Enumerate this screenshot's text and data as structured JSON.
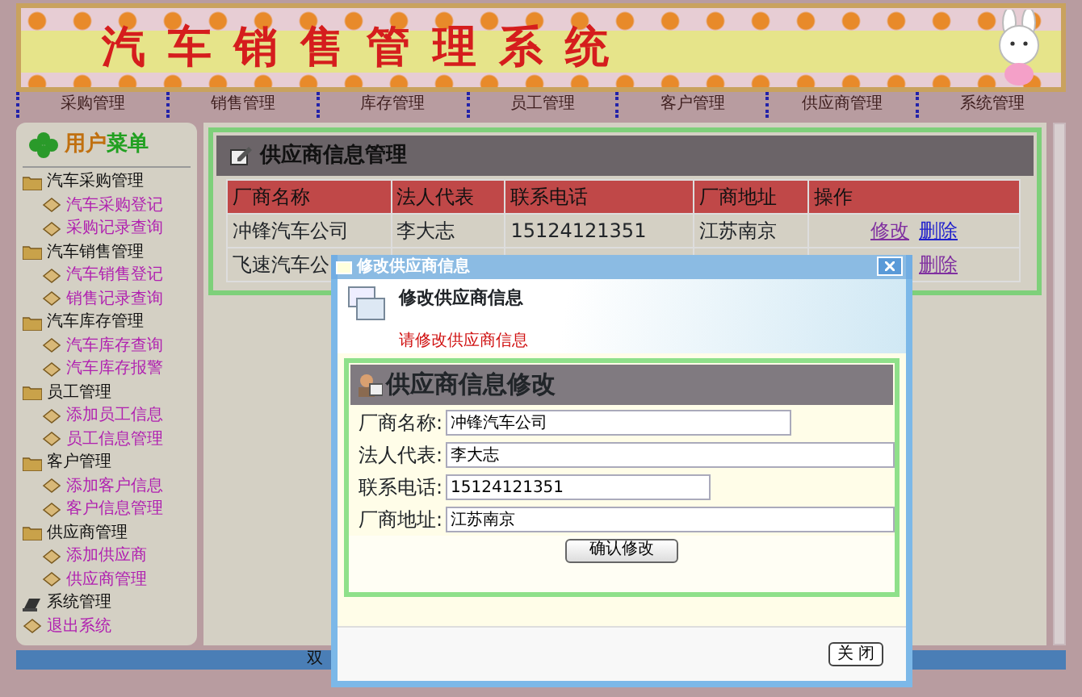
{
  "banner": {
    "title": "汽车销售管理系统"
  },
  "nav": [
    "采购管理",
    "销售管理",
    "库存管理",
    "员工管理",
    "客户管理",
    "供应商管理",
    "系统管理"
  ],
  "sidebar": {
    "title_parts": [
      "用户",
      "菜单"
    ],
    "items": [
      {
        "kind": "folder",
        "label": "汽车采购管理",
        "children": [
          {
            "label": "汽车采购登记"
          },
          {
            "label": "采购记录查询"
          }
        ]
      },
      {
        "kind": "folder",
        "label": "汽车销售管理",
        "children": [
          {
            "label": "汽车销售登记"
          },
          {
            "label": "销售记录查询"
          }
        ]
      },
      {
        "kind": "folder",
        "label": "汽车库存管理",
        "children": [
          {
            "label": "汽车库存查询"
          },
          {
            "label": "汽车库存报警"
          }
        ]
      },
      {
        "kind": "folder",
        "label": "员工管理",
        "children": [
          {
            "label": "添加员工信息"
          },
          {
            "label": "员工信息管理"
          }
        ]
      },
      {
        "kind": "folder",
        "label": "客户管理",
        "children": [
          {
            "label": "添加客户信息"
          },
          {
            "label": "客户信息管理"
          }
        ]
      },
      {
        "kind": "folder",
        "label": "供应商管理",
        "children": [
          {
            "label": "添加供应商"
          },
          {
            "label": "供应商管理"
          }
        ]
      },
      {
        "kind": "system",
        "label": "系统管理"
      },
      {
        "kind": "exit",
        "label": "退出系统"
      }
    ]
  },
  "panel": {
    "title": "供应商信息管理",
    "columns": [
      "厂商名称",
      "法人代表",
      "联系电话",
      "厂商地址",
      "操作"
    ],
    "rows": [
      {
        "name": "冲锋汽车公司",
        "legal_rep": "李大志",
        "phone": "15124121351",
        "address": "江苏南京",
        "actions": [
          "修改",
          "删除"
        ]
      },
      {
        "name": "飞速汽车公",
        "actions": [
          "删除"
        ]
      }
    ]
  },
  "dialog": {
    "title": "修改供应商信息",
    "header_title": "修改供应商信息",
    "header_hint": "请修改供应商信息",
    "form_title": "供应商信息修改",
    "fields": [
      {
        "label": "厂商名称:",
        "value": "冲锋汽车公司"
      },
      {
        "label": "法人代表:",
        "value": "李大志"
      },
      {
        "label": "联系电话:",
        "value": "15124121351"
      },
      {
        "label": "厂商地址:",
        "value": "江苏南京"
      }
    ],
    "submit": "确认修改",
    "close": "关 闭"
  },
  "status_bar": {
    "text": "双"
  }
}
